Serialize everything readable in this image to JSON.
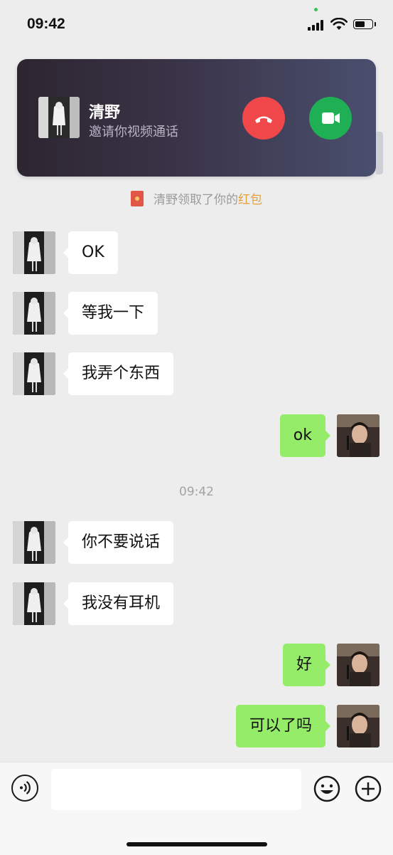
{
  "status_bar": {
    "time": "09:42"
  },
  "call_banner": {
    "caller_name": "清野",
    "subtitle": "邀请你视频通话",
    "colors": {
      "decline": "#F0484A",
      "accept": "#1FB055"
    },
    "icons": {
      "decline": "phone-hangup-icon",
      "accept": "video-camera-icon"
    }
  },
  "notice": {
    "prefix": "清野领取了你的",
    "highlight": "红包",
    "highlight_color": "#E4A13B"
  },
  "timestamp": "09:42",
  "messages": [
    {
      "direction": "in",
      "text": "OK"
    },
    {
      "direction": "in",
      "text": "等我一下"
    },
    {
      "direction": "in",
      "text": "我弄个东西"
    },
    {
      "direction": "out",
      "text": "ok"
    },
    {
      "direction": "in",
      "text": "你不要说话"
    },
    {
      "direction": "in",
      "text": "我没有耳机"
    },
    {
      "direction": "out",
      "text": "好"
    },
    {
      "direction": "out",
      "text": "可以了吗"
    }
  ],
  "bubble_colors": {
    "incoming": "#FFFFFF",
    "outgoing": "#95EC69"
  },
  "input_bar": {
    "value": "",
    "icons": [
      "voice-icon",
      "emoji-icon",
      "plus-icon"
    ]
  }
}
